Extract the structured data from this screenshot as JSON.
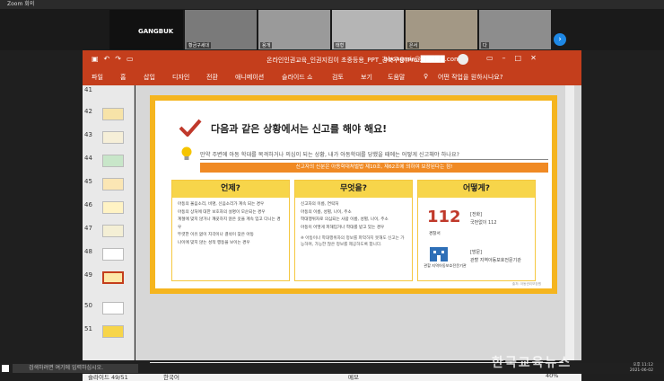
{
  "zoom": {
    "window_title": "Zoom 회의"
  },
  "gallery": {
    "main_tile_label": "GANGBUK",
    "participants": [
      "황금구세대",
      "용개",
      "태형",
      "은서",
      "다"
    ]
  },
  "ppt": {
    "document_title": "온라인인권교육_인권지킴이 초중등용_PPT_강북구용(Pro...",
    "user": "bbongmir@",
    "user_suffix": "com",
    "tabs": [
      "파일",
      "홈",
      "삽입",
      "디자인",
      "전환",
      "애니메이션",
      "슬라이드 쇼",
      "검토",
      "보기",
      "도움말",
      "어떤 작업을 원하시나요?"
    ]
  },
  "thumbs": [
    "41",
    "42",
    "43",
    "44",
    "45",
    "46",
    "47",
    "48",
    "49",
    "50",
    "51"
  ],
  "slide": {
    "title": "다음과 같은 상황에서는 신고를 해야 해요!",
    "question": "만약 주변에 아동 학대를 목격하거나 의심이 되는 상황, 내가 아동학대를 당했을 때에는 어떻게 신고해야 하나요?",
    "notice": "신고자의 신분은 아동학대처벌법 제10조, 제62조에 의하여 보장된다는 점!",
    "when": {
      "header": "언제?",
      "items": [
        "아동의 울음소리, 비명, 신음소리가 계속 되는 경우",
        "아동의 상처에 대한 보호자의 설명이 모순되는 경우",
        "계절에 맞지 않거나 깨끗하지 않은 옷을 계속 입고 다니는 경우",
        "뚜렷한 이유 없이 지각이나 결석이 잦은 아동",
        "나이에 맞지 않는 성적 행동을 보이는 경우"
      ]
    },
    "what": {
      "header": "무엇을?",
      "items": [
        "신고자의 이름, 연락처",
        "아동의 이름, 성별, 나이, 주소",
        "학대행위자로 의심되는 사람 이름, 성별, 나이, 주소",
        "아동이 어떻게 피해입거나 학대를 받고 있는 경우"
      ],
      "note": "※ 아동이나 학대행위자의 정보를 파악하지 못해도 신고는 가능하며, 가능한 많은 정보를 제공하도록 합니다."
    },
    "how": {
      "header": "어떻게?",
      "number": "112",
      "police_label": "경찰서",
      "police_lines": [
        "[전화]",
        "국번없이 112"
      ],
      "agency_label": "관할 지역아동보호전문기관",
      "agency_lines": [
        "[방문]",
        "관할 지역아동보호전문기관"
      ]
    },
    "source": "출처: 아동권리보장원"
  },
  "status": {
    "slide_info": "슬라이드 49/51",
    "language": "한국어",
    "notes": "메모",
    "zoom": "40%"
  },
  "taskbar": {
    "search_placeholder": "검색하려면 여기에 입력하십시오.",
    "time": "오후 11:12",
    "date": "2021-06-02"
  },
  "watermark": "한국교육뉴스",
  "colors": {
    "ppt_red": "#c43e1c",
    "slide_border": "#f5b51f",
    "header_yellow": "#f7d54a",
    "notice_orange": "#f08a24",
    "zoom_blue": "#1e88e5"
  }
}
